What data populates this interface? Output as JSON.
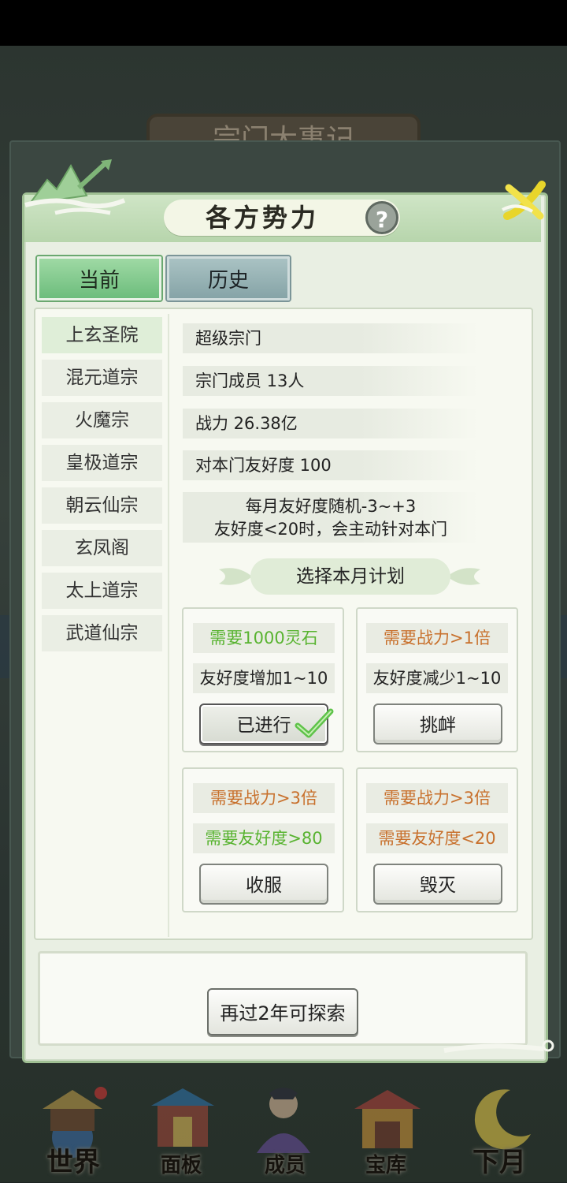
{
  "background": {
    "title": "宗门大事记"
  },
  "panel": {
    "title": "各方势力",
    "help_symbol": "?"
  },
  "tabs": [
    {
      "label": "当前",
      "active": true
    },
    {
      "label": "历史",
      "active": false
    }
  ],
  "sects": [
    {
      "name": "上玄圣院",
      "selected": true
    },
    {
      "name": "混元道宗",
      "selected": false
    },
    {
      "name": "火魔宗",
      "selected": false
    },
    {
      "name": "皇极道宗",
      "selected": false
    },
    {
      "name": "朝云仙宗",
      "selected": false
    },
    {
      "name": "玄凤阁",
      "selected": false
    },
    {
      "name": "太上道宗",
      "selected": false
    },
    {
      "name": "武道仙宗",
      "selected": false
    }
  ],
  "info": {
    "rank": "超级宗门",
    "members": "宗门成员 13人",
    "power": "战力 26.38亿",
    "friendship": "对本门友好度 100",
    "note_line1": "每月友好度随机-3~+3",
    "note_line2": "友好度<20时，会主动针对本门"
  },
  "plan": {
    "header": "选择本月计划",
    "cards": [
      {
        "req1": "需要1000灵石",
        "req1_color": "green",
        "req2": "友好度增加1~10",
        "req2_color": "dark",
        "action": "已进行",
        "done": true
      },
      {
        "req1": "需要战力>1倍",
        "req1_color": "orange",
        "req2": "友好度减少1~10",
        "req2_color": "dark",
        "action": "挑衅",
        "done": false
      },
      {
        "req1": "需要战力>3倍",
        "req1_color": "orange",
        "req2": "需要友好度>80",
        "req2_color": "green",
        "action": "收服",
        "done": false
      },
      {
        "req1": "需要战力>3倍",
        "req1_color": "orange",
        "req2": "需要友好度<20",
        "req2_color": "orange",
        "action": "毁灭",
        "done": false
      }
    ]
  },
  "footer": {
    "explore_label": "再过2年可探索"
  },
  "bottom_nav": [
    {
      "label": "世界",
      "icon": "world-temple-icon"
    },
    {
      "label": "面板",
      "icon": "panel-gate-icon"
    },
    {
      "label": "成员",
      "icon": "member-figure-icon"
    },
    {
      "label": "宝库",
      "icon": "treasury-icon"
    },
    {
      "label": "下月",
      "icon": "moon-icon"
    }
  ],
  "colors": {
    "accent_green": "#58b330",
    "accent_orange": "#c8702c",
    "panel_bg": "#e9efe3"
  }
}
